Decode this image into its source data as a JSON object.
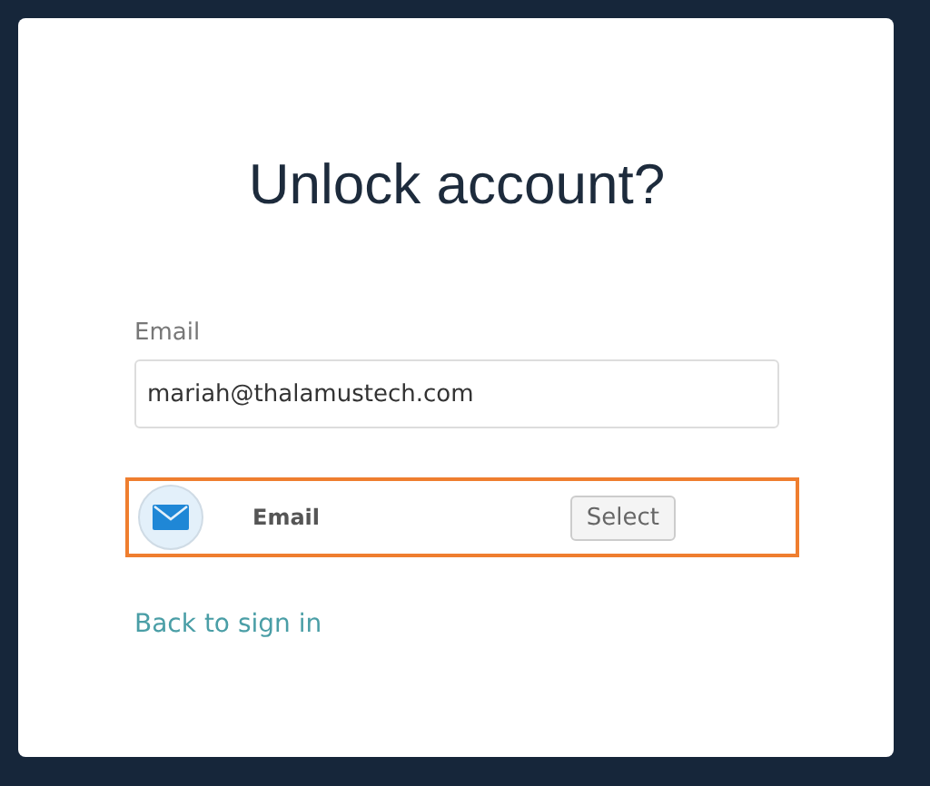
{
  "title": "Unlock account?",
  "email_field": {
    "label": "Email",
    "value": "mariah@thalamustech.com"
  },
  "factors": [
    {
      "label": "Email",
      "button": "Select",
      "highlighted": true
    }
  ],
  "back_link": "Back to sign in"
}
